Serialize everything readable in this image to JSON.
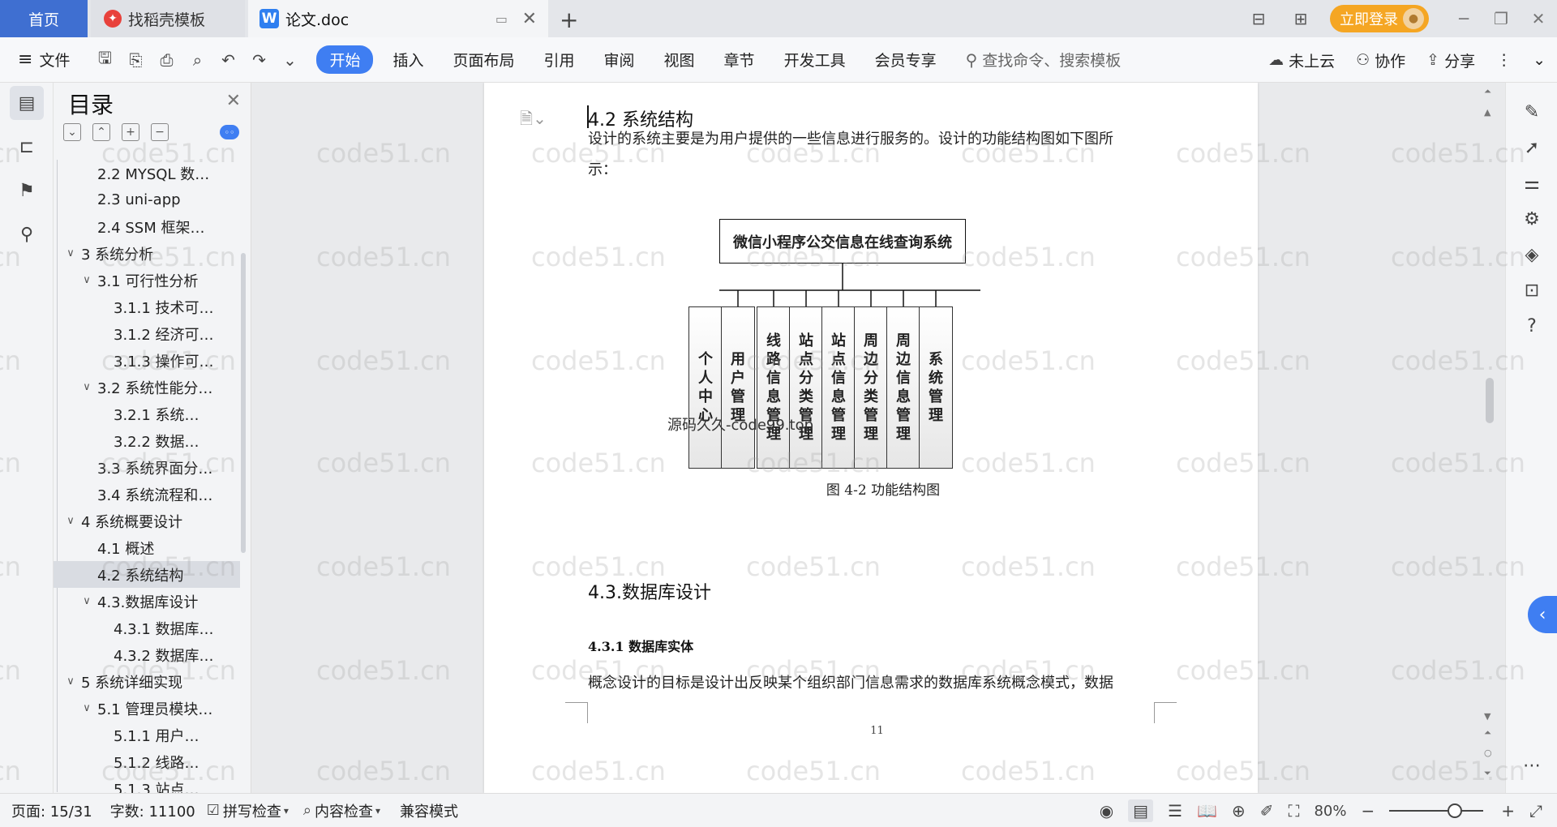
{
  "tabs": {
    "home": "首页",
    "daoke": "找稻壳模板",
    "doc": "论文.doc",
    "doc_logo": "W"
  },
  "title_right": {
    "login": "立即登录"
  },
  "toolbar": {
    "file": "文件",
    "tabs": [
      "开始",
      "插入",
      "页面布局",
      "引用",
      "审阅",
      "视图",
      "章节",
      "开发工具",
      "会员专享"
    ],
    "search_placeholder": "查找命令、搜索模板",
    "cloud": "未上云",
    "collab": "协作",
    "share": "分享"
  },
  "toc": {
    "title": "目录",
    "items": [
      {
        "label": "2.2 MYSQL 数…",
        "level": 2,
        "arrow": ""
      },
      {
        "label": "2.3 uni-app",
        "level": 2,
        "arrow": ""
      },
      {
        "label": "2.4 SSM 框架…",
        "level": 2,
        "arrow": ""
      },
      {
        "label": "3 系统分析",
        "level": 1,
        "arrow": "∨"
      },
      {
        "label": "3.1 可行性分析",
        "level": 2,
        "arrow": "∨"
      },
      {
        "label": "3.1.1 技术可…",
        "level": 3,
        "arrow": ""
      },
      {
        "label": "3.1.2 经济可…",
        "level": 3,
        "arrow": ""
      },
      {
        "label": "3.1.3 操作可…",
        "level": 3,
        "arrow": ""
      },
      {
        "label": "3.2 系统性能分…",
        "level": 2,
        "arrow": "∨"
      },
      {
        "label": "3.2.1 系统…",
        "level": 3,
        "arrow": ""
      },
      {
        "label": "3.2.2 数据…",
        "level": 3,
        "arrow": ""
      },
      {
        "label": "3.3 系统界面分…",
        "level": 2,
        "arrow": ""
      },
      {
        "label": "3.4 系统流程和…",
        "level": 2,
        "arrow": ""
      },
      {
        "label": "4 系统概要设计",
        "level": 1,
        "arrow": "∨"
      },
      {
        "label": "4.1 概述",
        "level": 2,
        "arrow": ""
      },
      {
        "label": "4.2 系统结构",
        "level": 2,
        "arrow": "",
        "selected": true
      },
      {
        "label": "4.3.数据库设计",
        "level": 2,
        "arrow": "∨"
      },
      {
        "label": "4.3.1 数据库…",
        "level": 3,
        "arrow": ""
      },
      {
        "label": "4.3.2 数据库…",
        "level": 3,
        "arrow": ""
      },
      {
        "label": "5 系统详细实现",
        "level": 1,
        "arrow": "∨"
      },
      {
        "label": "5.1 管理员模块…",
        "level": 2,
        "arrow": "∨"
      },
      {
        "label": "5.1.1 用户…",
        "level": 3,
        "arrow": ""
      },
      {
        "label": "5.1.2 线路…",
        "level": 3,
        "arrow": ""
      },
      {
        "label": "5.1.3 站点…",
        "level": 3,
        "arrow": ""
      }
    ]
  },
  "document": {
    "heading": "4.2 系统结构",
    "para1_line1": "设计的系统主要是为用户提供的一些信息进行服务的。设计的功能结构图如下图所",
    "para1_line2": "示：",
    "diagram_title": "微信小程序公交信息在线查询系统",
    "diagram_boxes": [
      "个人中心",
      "用户管理",
      "线路信息管理",
      "站点分类管理",
      "站点信息管理",
      "周边分类管理",
      "周边信息管理",
      "系统管理"
    ],
    "overlay_text": "源码久久-code99.top",
    "caption": "图 4-2 功能结构图",
    "heading2": "4.3.数据库设计",
    "heading3": "4.3.1 数据库实体",
    "para2": "概念设计的目标是设计出反映某个组织部门信息需求的数据库系统概念模式，数据",
    "page_number": "11"
  },
  "watermark": "code51.cn",
  "status": {
    "page": "页面: 15/31",
    "words": "字数: 11100",
    "spell": "拼写检查",
    "content_check": "内容检查",
    "compat": "兼容模式",
    "zoom": "80%"
  }
}
